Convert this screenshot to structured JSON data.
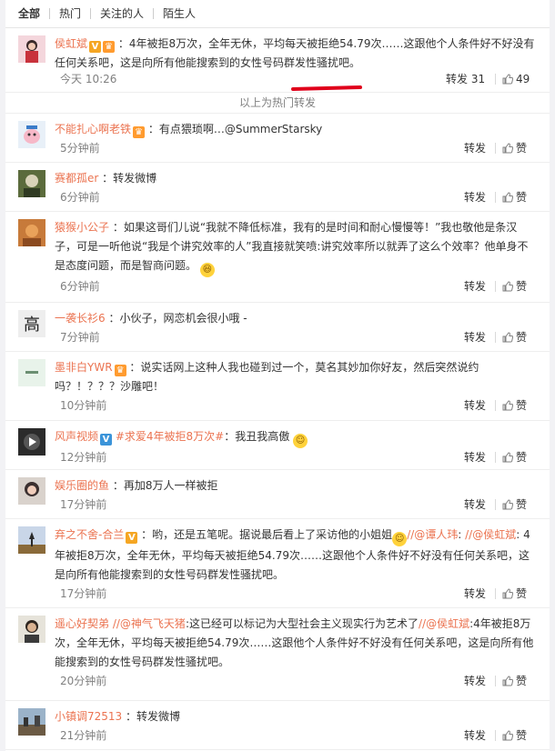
{
  "tabs": [
    "全部",
    "热门",
    "关注的人",
    "陌生人"
  ],
  "hot_separator": "以上为热门转发",
  "forward_label": "转发",
  "like_label": "赞",
  "items": [
    {
      "user": "侯虹斌",
      "text": "：4年被拒8万次，全年无休，平均每天被拒绝54.79次……这跟他个人条件好不好没有任何关系吧，这是向所有他能搜索到的女性号码群发性骚扰吧。",
      "time": "今天 10:26",
      "forward": "转发 31",
      "like": "49"
    },
    {
      "user": "不能扎心啊老铁",
      "text": "：有点猥琐啊…@SummerStarsky",
      "time": "5分钟前"
    },
    {
      "user": "赛都孤er",
      "text": "：转发微博",
      "time": "6分钟前"
    },
    {
      "user": "猿猴小公子",
      "text": "：如果这哥们儿说“我就不降低标准，我有的是时间和耐心慢慢等！”我也敬他是条汉子，可是一听他说“我是个讲究效率的人”我直接就笑喷:讲究效率所以就弄了这么个效率？他单身不是态度问题，而是智商问题。",
      "time": "6分钟前"
    },
    {
      "user": "一袭长衫6",
      "text": "：小伙子，网恋机会很小哦 -",
      "time": "7分钟前",
      "avatar_char": "高"
    },
    {
      "user": "墨非白YWR",
      "text": "：说实话网上这种人我也碰到过一个，莫名其妙加你好友，然后突然说约吗？！？？？沙雕吧！",
      "time": "10分钟前"
    },
    {
      "user": "风声视频",
      "topic": "#求爱4年被拒8万次#",
      "text": "：我丑我高傲",
      "time": "12分钟前"
    },
    {
      "user": "娱乐圈的鱼",
      "text": "：再加8万人一样被拒",
      "time": "17分钟前"
    },
    {
      "user": "弃之不舍-合兰",
      "text_a": "：哟，还是五笔呢。据说最后看上了采访他的小姐姐",
      "mention1": "//@谭人玮",
      "text_b": ": ",
      "mention2": "//@侯虹斌",
      "text_c": ": 4年被拒8万次，全年无休，平均每天被拒绝54.79次……这跟他个人条件好不好没有任何关系吧，这是向所有他能搜索到的女性号码群发性骚扰吧。",
      "time": "17分钟前"
    },
    {
      "user": "遥心好契弟",
      "mention1": "//@神气飞天猪",
      "text_a": ":这已经可以标记为大型社会主义现实行为艺术了",
      "mention2": "//@侯虹斌",
      "text_b": ":4年被拒8万次，全年无休，平均每天被拒绝54.79次……这跟他个人条件好不好没有任何关系吧，这是向所有他能搜索到的女性号码群发性骚扰吧。",
      "time": "20分钟前"
    },
    {
      "user": "小镇调72513",
      "text": "：转发微博",
      "time": "21分钟前"
    }
  ]
}
